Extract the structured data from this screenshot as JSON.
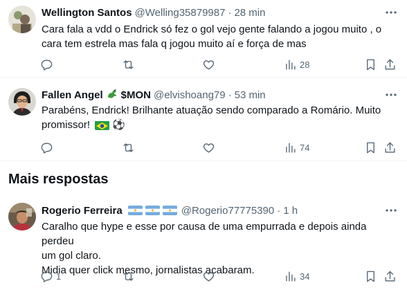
{
  "section": {
    "title": "Mais respostas"
  },
  "tweets": [
    {
      "name": "Wellington Santos",
      "handle": "@Welling35879987",
      "time": "28 min",
      "lines": [
        "Cara fala a vdd o Endrick só fez o gol vejo gente falando a jogou muito , o",
        "cara tem estrela mas fala q jogou muito aí e força de mas"
      ],
      "reply_count": "",
      "retweet_count": "",
      "like_count": "",
      "views": "28"
    },
    {
      "name": "Fallen Angel",
      "name_suffix": "$MON",
      "handle": "@elvishoang79",
      "time": "53 min",
      "lines": [
        "Parabéns, Endrick! Brilhante atuação sendo comparado a Romário. Muito",
        "promissor!"
      ],
      "emoji": "⚽",
      "reply_count": "",
      "retweet_count": "",
      "like_count": "",
      "views": "74"
    },
    {
      "name": "Rogerio Ferreira",
      "handle": "@Rogerio77775390",
      "time": "1 h",
      "lines": [
        "Caralho que hype e esse por causa de uma empurrada e depois ainda perdeu",
        "um gol claro.",
        "Midia quer click mesmo, jornalistas acabaram."
      ],
      "reply_count": "1",
      "retweet_count": "",
      "like_count": "",
      "views": "34"
    }
  ],
  "icons": {
    "reply": "reply-icon",
    "retweet": "retweet-icon",
    "like": "like-icon",
    "views": "views-icon",
    "bookmark": "bookmark-icon",
    "share": "share-icon",
    "more": "more-icon",
    "dragon": "dragon-emoji-icon",
    "brazil_flag": "brazil-flag-icon",
    "argentina_flag": "argentina-flag-icon"
  },
  "colors": {
    "text": "#0f1419",
    "secondary": "#536471",
    "divider": "#eff3f4"
  }
}
